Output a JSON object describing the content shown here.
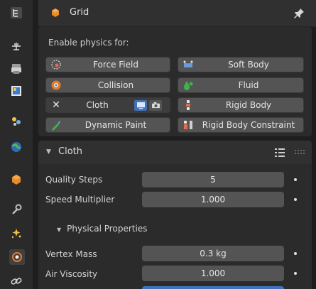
{
  "header": {
    "title": "Grid"
  },
  "physics": {
    "label": "Enable physics for:",
    "buttons": {
      "force_field": "Force Field",
      "soft_body": "Soft Body",
      "collision": "Collision",
      "fluid": "Fluid",
      "cloth": "Cloth",
      "rigid_body": "Rigid Body",
      "dynamic_paint": "Dynamic Paint",
      "rigid_body_constraint": "Rigid Body Constraint"
    },
    "cloth_remove_glyph": "✕"
  },
  "cloth_panel": {
    "title": "Cloth",
    "quality_steps": {
      "label": "Quality Steps",
      "value": "5"
    },
    "speed_multiplier": {
      "label": "Speed Multiplier",
      "value": "1.000"
    },
    "physical_properties": {
      "title": "Physical Properties",
      "vertex_mass": {
        "label": "Vertex Mass",
        "value": "0.3 kg"
      },
      "air_viscosity": {
        "label": "Air Viscosity",
        "value": "1.000"
      }
    }
  },
  "colors": {
    "accent_blue": "#3f70b8",
    "object_orange": "#e98c2a",
    "physics_orange": "#e77a2b"
  },
  "icons": {
    "sidebar": [
      "tool-icon",
      "render-icon",
      "output-icon",
      "view-layer-icon",
      "scene-icon",
      "world-icon",
      "object-icon",
      "modifier-icon",
      "particles-icon",
      "physics-icon",
      "constraints-icon"
    ]
  }
}
